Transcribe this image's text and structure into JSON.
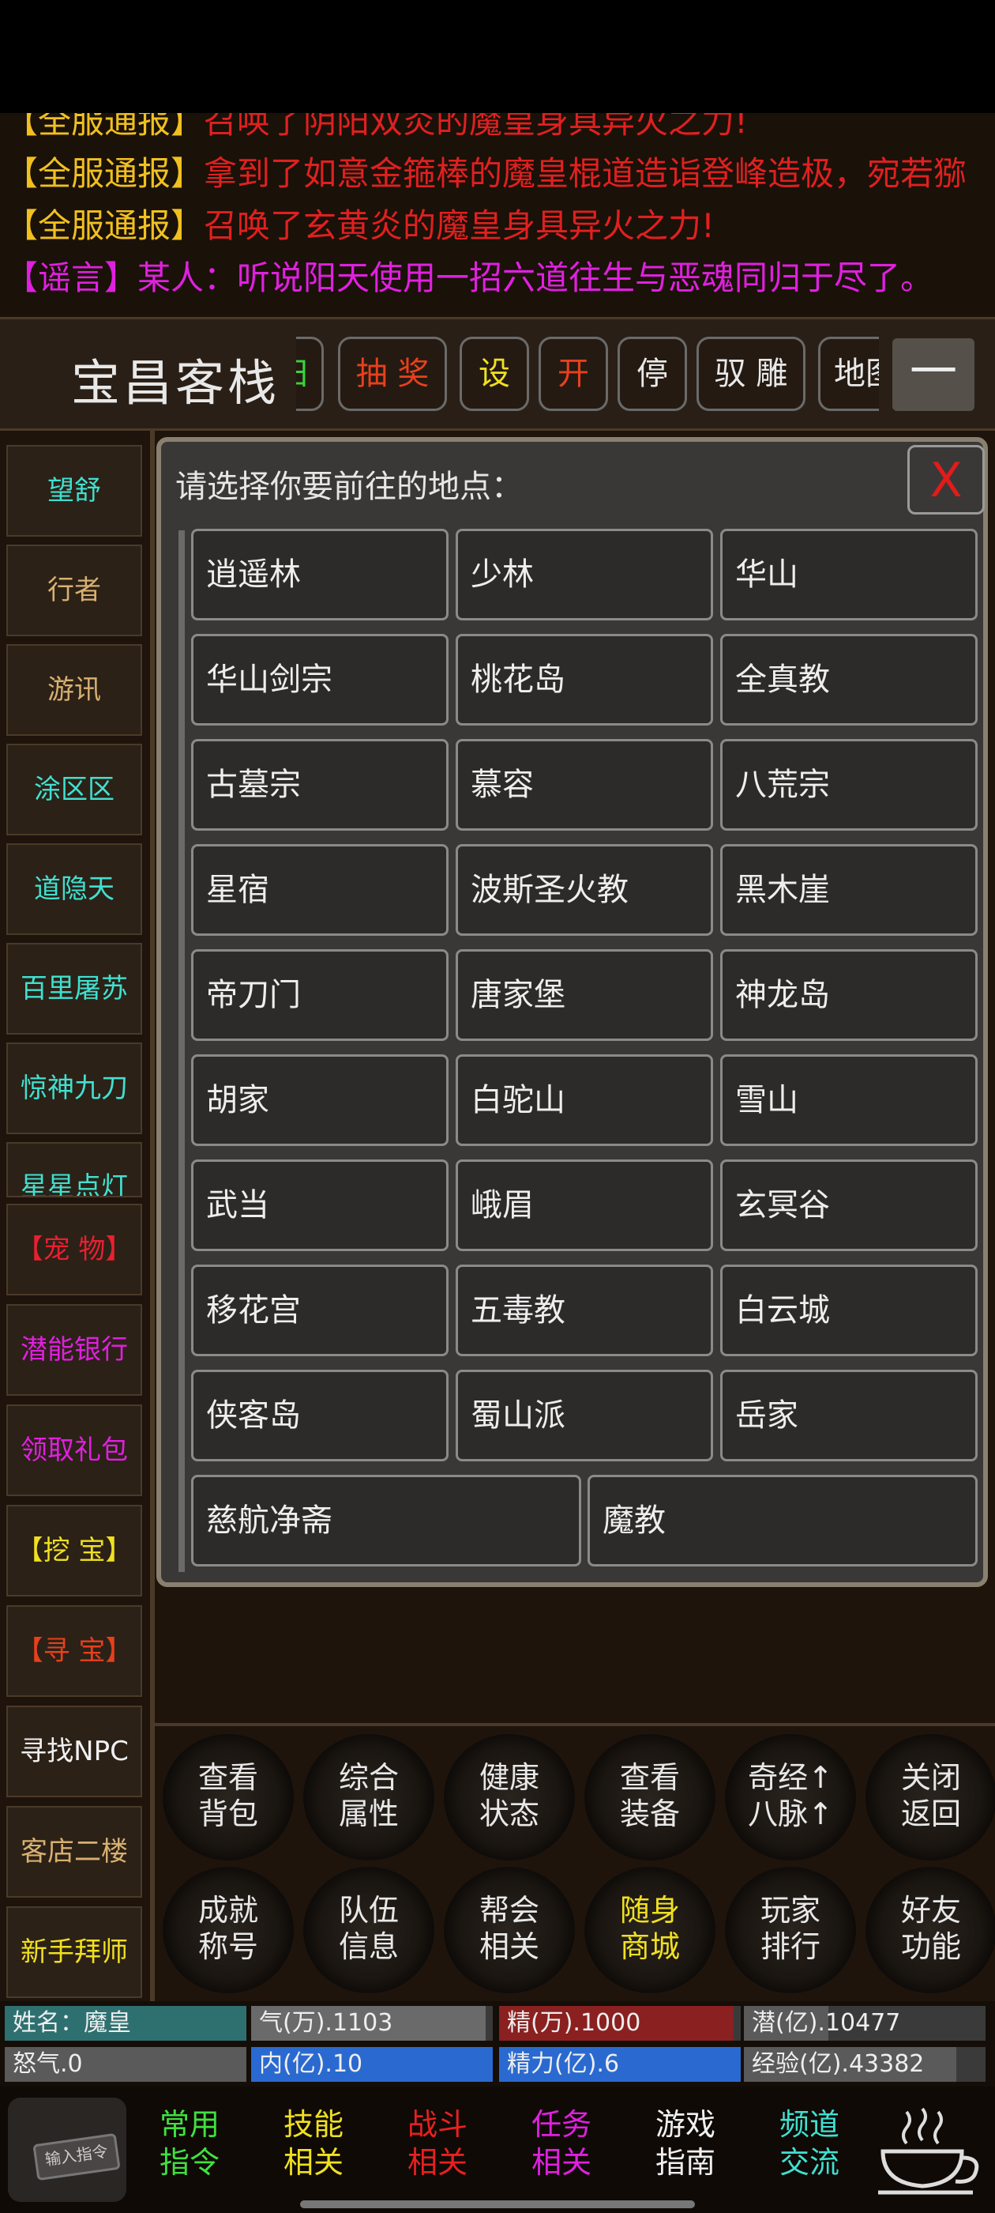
{
  "news": [
    {
      "tag": "【全服通报】",
      "text": "召唤了阴阳双炎的魔皇身具异火之力!",
      "tag_color": "#f0c020",
      "text_color": "#e02020"
    },
    {
      "tag": "【全服通报】",
      "text": "拿到了如意金箍棒的魔皇棍道造诣登峰造极，宛若猕",
      "tag_color": "#f0c020",
      "text_color": "#e02020"
    },
    {
      "tag": "【全服通报】",
      "text": "召唤了玄黄炎的魔皇身具异火之力!",
      "tag_color": "#f0c020",
      "text_color": "#e02020"
    },
    {
      "tag": "【谣言】",
      "text": "某人：听说阳天使用一招六道往生与恶魂同归于尽了。",
      "tag_color": "#e020e0",
      "text_color": "#e020e0"
    }
  ],
  "header": {
    "location": "宝昌客栈",
    "buttons": [
      {
        "label": "彐",
        "color": "#3bd33b"
      },
      {
        "label": "抽 奖",
        "color": "#e8401c"
      },
      {
        "label": "设",
        "color": "#f0e020"
      },
      {
        "label": "开",
        "color": "#e8401c"
      },
      {
        "label": "停",
        "color": "#e8e8e8"
      },
      {
        "label": "驭 雕",
        "color": "#e8e8e8"
      },
      {
        "label": "地图",
        "color": "#e8e8e8"
      }
    ],
    "collapse_label": "一"
  },
  "sidebar": [
    {
      "label": "望舒",
      "color": "#40e0d0"
    },
    {
      "label": "行者",
      "color": "#d8b070"
    },
    {
      "label": "游讯",
      "color": "#d8b070"
    },
    {
      "label": "涂区区",
      "color": "#40e0d0"
    },
    {
      "label": "道隐天",
      "color": "#40e0d0"
    },
    {
      "label": "百里屠苏",
      "color": "#40e0d0"
    },
    {
      "label": "惊神九刀",
      "color": "#40e0d0"
    },
    {
      "label": "星星点灯",
      "color": "#40e0d0"
    },
    {
      "label": "【宠 物】",
      "color": "#e82030"
    },
    {
      "label": "潜能银行",
      "color": "#e020e0"
    },
    {
      "label": "领取礼包",
      "color": "#e020e0"
    },
    {
      "label": "【挖 宝】",
      "color": "#f0e020"
    },
    {
      "label": "【寻 宝】",
      "color": "#e8401c"
    },
    {
      "label": "寻找NPC",
      "color": "#f0f0f0"
    },
    {
      "label": "客店二楼",
      "color": "#d8b070"
    },
    {
      "label": "新手拜师",
      "color": "#f0e020"
    }
  ],
  "dialog": {
    "title": "请选择你要前往的地点：",
    "close_label": "X",
    "destinations": [
      "逍遥林",
      "少林",
      "华山",
      "华山剑宗",
      "桃花岛",
      "全真教",
      "古墓宗",
      "慕容",
      "八荒宗",
      "星宿",
      "波斯圣火教",
      "黑木崖",
      "帝刀门",
      "唐家堡",
      "神龙岛",
      "胡家",
      "白驼山",
      "雪山",
      "武当",
      "峨眉",
      "玄冥谷",
      "移花宫",
      "五毒教",
      "白云城",
      "侠客岛",
      "蜀山派",
      "岳家"
    ],
    "last_row": [
      "慈航净斋",
      "魔教"
    ]
  },
  "functions": [
    {
      "l1": "查看",
      "l2": "背包",
      "color": "#e8e8e8"
    },
    {
      "l1": "综合",
      "l2": "属性",
      "color": "#e8e8e8"
    },
    {
      "l1": "健康",
      "l2": "状态",
      "color": "#e8e8e8"
    },
    {
      "l1": "查看",
      "l2": "装备",
      "color": "#e8e8e8"
    },
    {
      "l1": "奇经↑",
      "l2": "八脉↑",
      "color": "#e8e8e8"
    },
    {
      "l1": "关闭",
      "l2": "返回",
      "color": "#e8e8e8"
    },
    {
      "l1": "成就",
      "l2": "称号",
      "color": "#e8e8e8"
    },
    {
      "l1": "队伍",
      "l2": "信息",
      "color": "#e8e8e8"
    },
    {
      "l1": "帮会",
      "l2": "相关",
      "color": "#e8e8e8"
    },
    {
      "l1": "随身",
      "l2": "商城",
      "color": "#f0e020"
    },
    {
      "l1": "玩家",
      "l2": "排行",
      "color": "#e8e8e8"
    },
    {
      "l1": "好友",
      "l2": "功能",
      "color": "#e8e8e8"
    }
  ],
  "stats": [
    {
      "text": "姓名：魔皇",
      "fill_color": "#2e7070",
      "fill": 1.0
    },
    {
      "text": "气(万).1103",
      "fill_color": "#6a6a6a",
      "fill": 0.97
    },
    {
      "text": "精(万).1000",
      "fill_color": "#8a2020",
      "fill": 0.97
    },
    {
      "text": "潜(亿).10477",
      "fill_color": "#5a5a5a",
      "fill": 0.35
    },
    {
      "text": "怒气.0",
      "fill_color": "#5a5a5a",
      "fill": 1.0
    },
    {
      "text": "内(亿).10",
      "fill_color": "#2a6ad0",
      "fill": 1.0
    },
    {
      "text": "精力(亿).6",
      "fill_color": "#2a6ad0",
      "fill": 1.0
    },
    {
      "text": "经验(亿).43382",
      "fill_color": "#5a5a5a",
      "fill": 0.88
    }
  ],
  "bottom_nav": {
    "input_label": "输入指令",
    "items": [
      {
        "l1": "常用",
        "l2": "指令",
        "color": "#40e040"
      },
      {
        "l1": "技能",
        "l2": "相关",
        "color": "#f0e020"
      },
      {
        "l1": "战斗",
        "l2": "相关",
        "color": "#e82020"
      },
      {
        "l1": "任务",
        "l2": "相关",
        "color": "#e020e0"
      },
      {
        "l1": "游戏",
        "l2": "指南",
        "color": "#f0f0f0"
      },
      {
        "l1": "频道",
        "l2": "交流",
        "color": "#40e0d0"
      }
    ]
  }
}
